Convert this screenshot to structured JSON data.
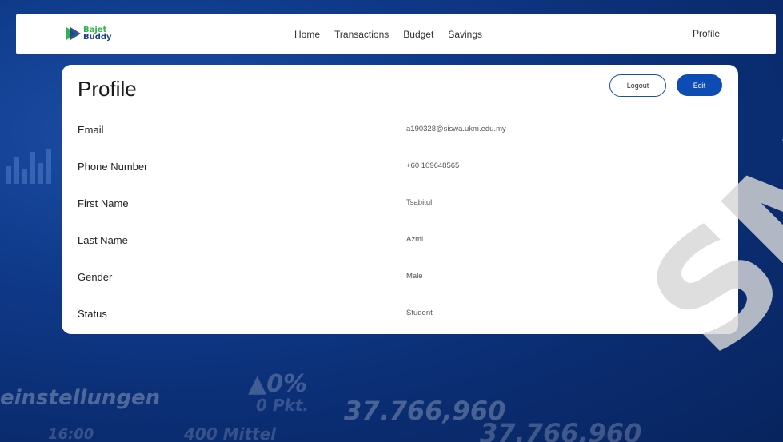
{
  "brand": {
    "line1": "Bajet",
    "line2": "Buddy",
    "colors": {
      "primary": "#0d4db3",
      "green": "#2fb34a"
    }
  },
  "navbar": {
    "links": [
      "Home",
      "Transactions",
      "Budget",
      "Savings"
    ],
    "profile_label": "Profile"
  },
  "profile": {
    "title": "Profile",
    "logout_label": "Logout",
    "edit_label": "Edit",
    "fields": [
      {
        "label": "Email",
        "value": "a190328@siswa.ukm.edu.my"
      },
      {
        "label": "Phone Number",
        "value": "+60 109648565"
      },
      {
        "label": "First Name",
        "value": "Tsabitul"
      },
      {
        "label": "Last Name",
        "value": "Azmi"
      },
      {
        "label": "Gender",
        "value": "Male"
      },
      {
        "label": "Status",
        "value": "Student"
      }
    ]
  },
  "background_ticker": [
    "einstellungen",
    "16:00",
    "▲0%",
    "0 Pkt.",
    "400 Mittel",
    "37.766,960",
    "37.766,960"
  ],
  "watermark": "SM"
}
